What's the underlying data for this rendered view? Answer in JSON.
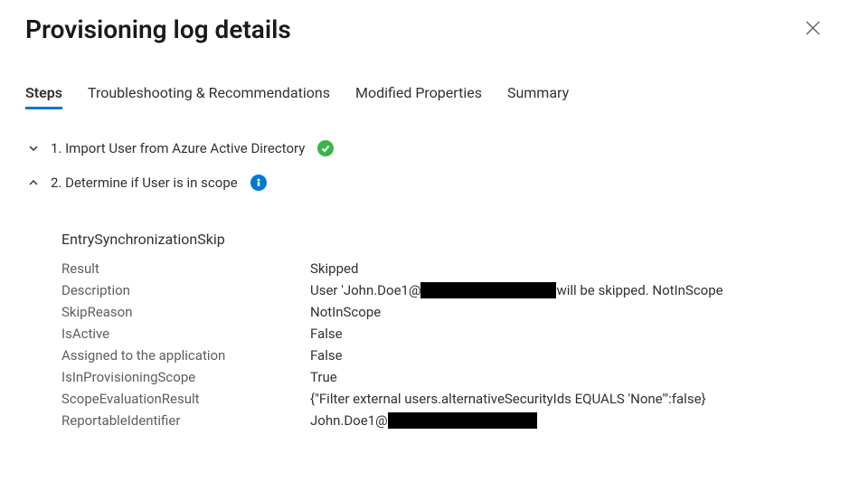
{
  "title": "Provisioning log details",
  "tabs": {
    "steps": "Steps",
    "troubleshooting": "Troubleshooting & Recommendations",
    "modified": "Modified Properties",
    "summary": "Summary"
  },
  "steps": {
    "step1": {
      "label": "1. Import User from Azure Active Directory"
    },
    "step2": {
      "label": "2. Determine if User is in scope"
    }
  },
  "details": {
    "header": "EntrySynchronizationSkip",
    "labels": {
      "result": "Result",
      "description": "Description",
      "skipReason": "SkipReason",
      "isActive": "IsActive",
      "assigned": "Assigned to the application",
      "inScope": "IsInProvisioningScope",
      "scopeEval": "ScopeEvaluationResult",
      "reportable": "ReportableIdentifier"
    },
    "values": {
      "result": "Skipped",
      "description_prefix": "User 'John.Doe1@",
      "description_suffix": " will be skipped. NotInScope",
      "skipReason": "NotInScope",
      "isActive": "False",
      "assigned": "False",
      "inScope": "True",
      "scopeEval": "{\"Filter external users.alternativeSecurityIds EQUALS 'None'\":false}",
      "reportable_prefix": "John.Doe1@"
    }
  }
}
